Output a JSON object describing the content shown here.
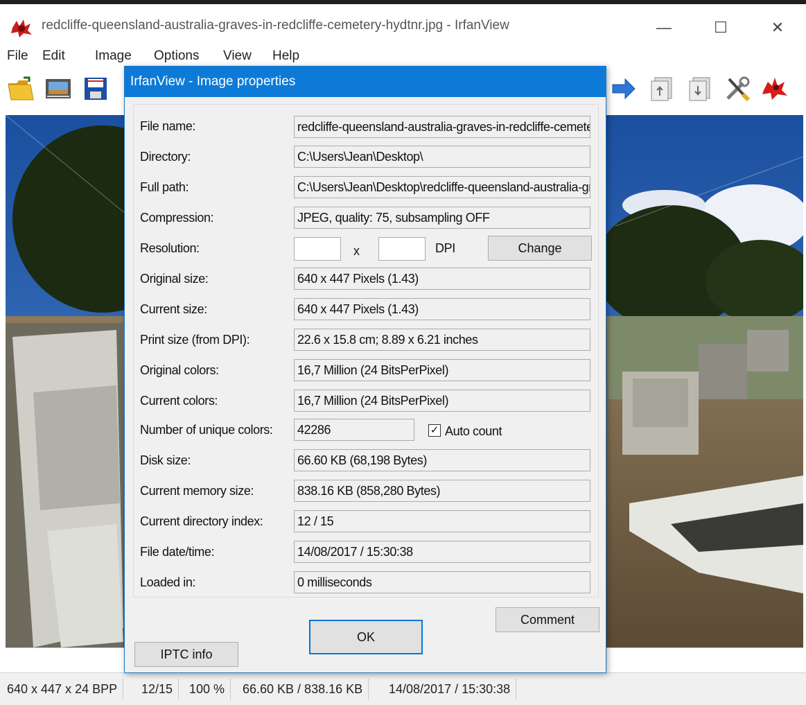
{
  "window": {
    "title": "redcliffe-queensland-australia-graves-in-redcliffe-cemetery-hydtnr.jpg - IrfanView",
    "minimize": "—",
    "maximize": "☐",
    "close": "✕"
  },
  "menu": [
    "File",
    "Edit",
    "Image",
    "Options",
    "View",
    "Help"
  ],
  "toolbar_icons": [
    "open-folder-icon",
    "slideshow-icon",
    "save-icon",
    "next-arrow-icon",
    "copy-page-icon",
    "paste-page-icon",
    "settings-tools-icon",
    "irfanview-logo-icon"
  ],
  "dialog": {
    "title": "IrfanView - Image properties",
    "rows": [
      {
        "label": "File name:",
        "value": "redcliffe-queensland-australia-graves-in-redcliffe-cemetery-hydtnr.jpg"
      },
      {
        "label": "Directory:",
        "value": "C:\\Users\\Jean\\Desktop\\"
      },
      {
        "label": "Full path:",
        "value": "C:\\Users\\Jean\\Desktop\\redcliffe-queensland-australia-graves-in-redcliffe-cemetery-hydtnr.jpg"
      },
      {
        "label": "Compression:",
        "value": "JPEG, quality: 75, subsampling OFF"
      },
      {
        "label": "Resolution:",
        "value": ""
      },
      {
        "label": "Original size:",
        "value": "640 x 447  Pixels (1.43)"
      },
      {
        "label": "Current size:",
        "value": "640 x 447  Pixels (1.43)"
      },
      {
        "label": "Print size (from DPI):",
        "value": "22.6 x 15.8 cm; 8.89 x 6.21 inches"
      },
      {
        "label": "Original colors:",
        "value": "16,7 Million   (24 BitsPerPixel)"
      },
      {
        "label": "Current colors:",
        "value": "16,7 Million   (24 BitsPerPixel)"
      },
      {
        "label": "Number of unique colors:",
        "value": "42286"
      },
      {
        "label": "Disk size:",
        "value": "66.60 KB (68,198 Bytes)"
      },
      {
        "label": "Current memory size:",
        "value": "838.16  KB (858,280 Bytes)"
      },
      {
        "label": "Current directory index:",
        "value": "12  /  15"
      },
      {
        "label": "File date/time:",
        "value": "14/08/2017 / 15:30:38"
      },
      {
        "label": "Loaded in:",
        "value": "0 milliseconds"
      }
    ],
    "resolution": {
      "x_value": "",
      "y_value": "",
      "x_sep": "x",
      "unit": "DPI",
      "change_label": "Change"
    },
    "auto_count": {
      "label": "Auto count",
      "checked": true,
      "mark": "✓"
    },
    "buttons": {
      "comment": "Comment",
      "ok": "OK",
      "iptc": "IPTC info"
    }
  },
  "status": [
    "640 x 447 x 24 BPP",
    "12/15",
    "100 %",
    "66.60 KB / 838.16 KB",
    "14/08/2017 / 15:30:38"
  ],
  "colors": {
    "accent": "#0d7ad7",
    "dialog_bg": "#f0f0f0",
    "sky": "#2a5fb3"
  }
}
